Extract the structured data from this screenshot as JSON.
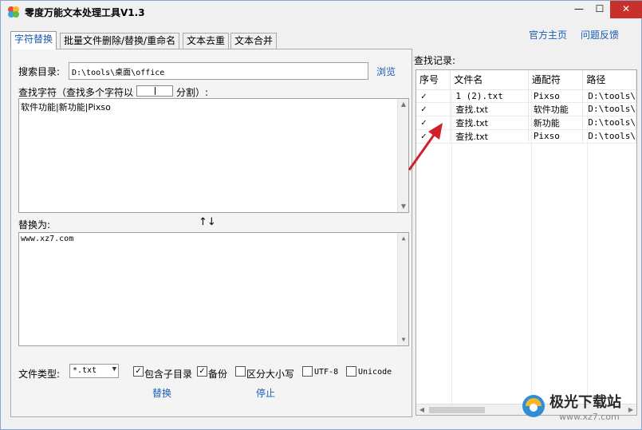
{
  "window": {
    "title": "零度万能文本处理工具V1.3",
    "controls": {
      "minimize": "—",
      "maximize": "☐",
      "close": "✕"
    }
  },
  "tabs": [
    "字符替换",
    "批量文件删除/替换/重命名",
    "文本去重",
    "文本合并"
  ],
  "links": {
    "home": "官方主页",
    "feedback": "问题反馈"
  },
  "form": {
    "search_dir_label": "搜索目录:",
    "search_dir_value": "D:\\tools\\桌面\\office",
    "browse": "浏览",
    "find_label_prefix": "查找字符（查找多个字符以",
    "find_label_suffix": "分割）:",
    "separator_value": "|",
    "find_value": "软件功能|新功能|Pixso",
    "replace_label": "替换为:",
    "swap_arrows": "↑↓",
    "replace_value": "www.xz7.com",
    "file_type_label": "文件类型:",
    "file_type_value": "*.txt",
    "options": [
      {
        "label": "包含子目录",
        "checked": true
      },
      {
        "label": "备份",
        "checked": true
      },
      {
        "label": "区分大小写",
        "checked": false
      },
      {
        "label": "UTF-8",
        "checked": false
      },
      {
        "label": "Unicode",
        "checked": false
      }
    ],
    "replace_button": "替换",
    "stop_button": "停止"
  },
  "results": {
    "label": "查找记录:",
    "columns": [
      "序号",
      "文件名",
      "通配符",
      "路径"
    ],
    "rows": [
      [
        "✓",
        "1 (2).txt",
        "Pixso",
        "D:\\tools\\"
      ],
      [
        "✓",
        "查找.txt",
        "软件功能",
        "D:\\tools\\"
      ],
      [
        "✓",
        "查找.txt",
        "新功能",
        "D:\\tools\\"
      ],
      [
        "✓",
        "查找.txt",
        "Pixso",
        "D:\\tools\\"
      ]
    ]
  },
  "watermark": {
    "text": "极光下载站",
    "url": "www.xz7.com"
  },
  "colors": {
    "accent": "#1b5db7",
    "close": "#c7302b",
    "arrow": "#d0202a"
  }
}
